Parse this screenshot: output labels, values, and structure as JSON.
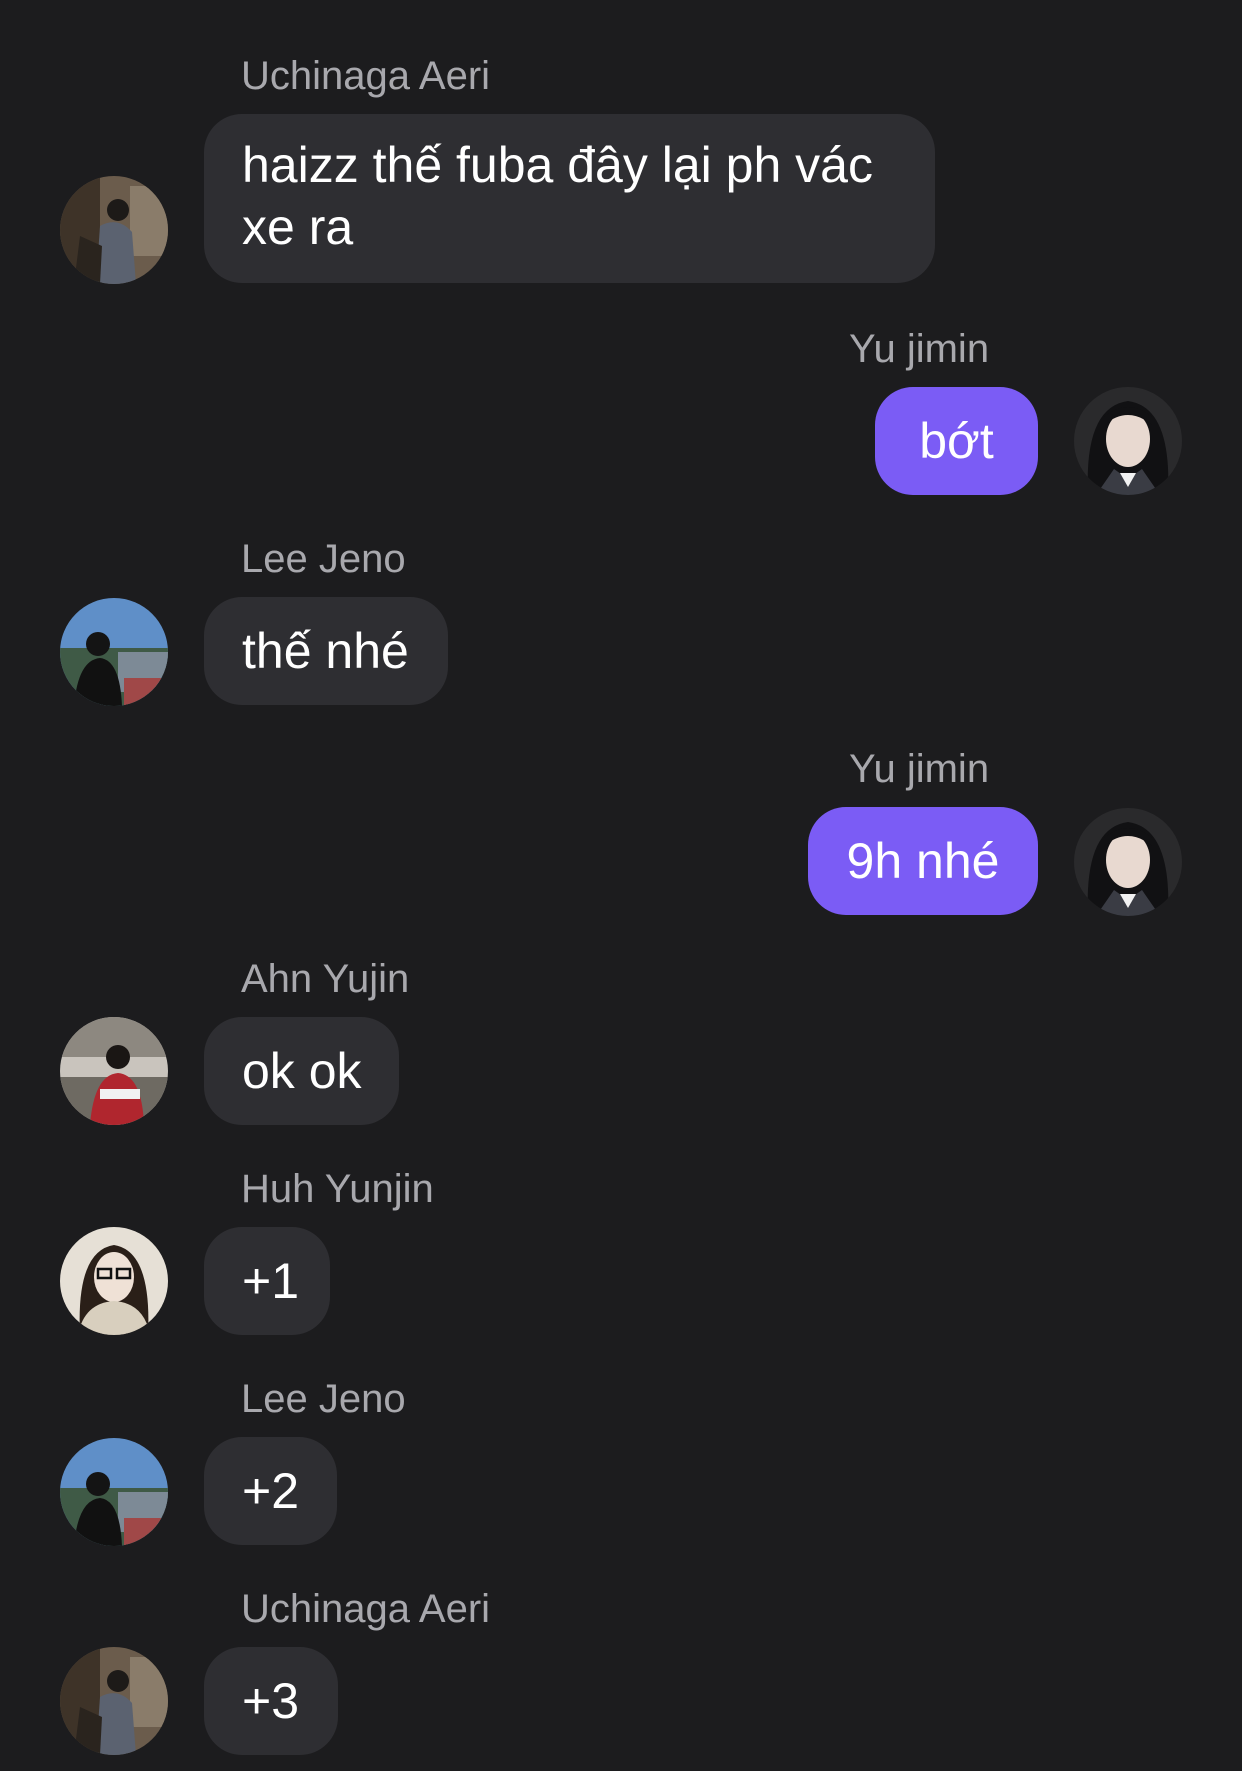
{
  "messages": [
    {
      "sender": "Uchinaga Aeri",
      "text": "haizz thế fuba đây lại ph vác xe ra",
      "direction": "incoming",
      "avatar": "aeri-avatar"
    },
    {
      "sender": "Yu jimin",
      "text": "bớt",
      "direction": "outgoing",
      "avatar": "jimin-avatar"
    },
    {
      "sender": "Lee Jeno",
      "text": "thế nhé",
      "direction": "incoming",
      "avatar": "jeno-avatar"
    },
    {
      "sender": "Yu jimin",
      "text": "9h nhé",
      "direction": "outgoing",
      "avatar": "jimin-avatar"
    },
    {
      "sender": "Ahn Yujin",
      "text": "ok ok",
      "direction": "incoming",
      "avatar": "yujin-avatar"
    },
    {
      "sender": "Huh Yunjin",
      "text": "+1",
      "direction": "incoming",
      "avatar": "yunjin-avatar"
    },
    {
      "sender": "Lee Jeno",
      "text": "+2",
      "direction": "incoming",
      "avatar": "jeno-avatar"
    },
    {
      "sender": "Uchinaga Aeri",
      "text": "+3",
      "direction": "incoming",
      "avatar": "aeri-avatar"
    }
  ],
  "colors": {
    "background": "#1c1c1e",
    "incoming_bubble": "#2e2e32",
    "outgoing_bubble": "#7b5cf5",
    "sender_name": "#a8a8ad"
  }
}
